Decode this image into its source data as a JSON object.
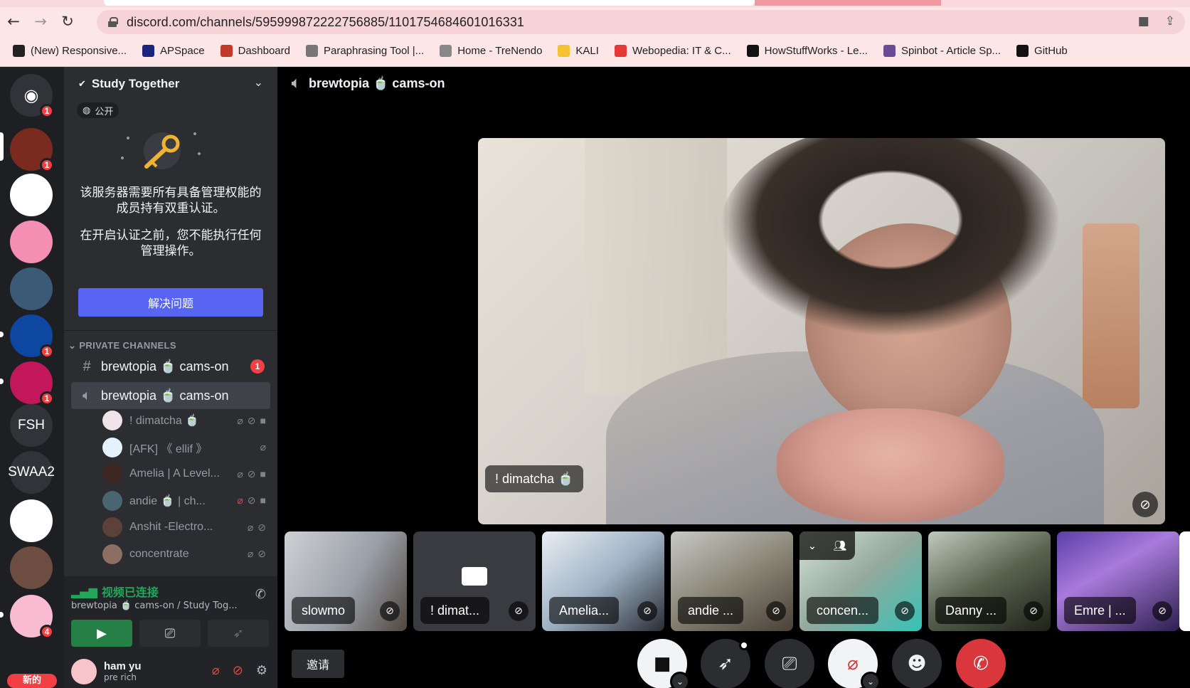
{
  "browser": {
    "url": "discord.com/channels/595999872222756885/1101754684601016331",
    "bookmarks": [
      {
        "label": "(New) Responsive...",
        "icon": "fc-logo-icon",
        "color": "#222"
      },
      {
        "label": "APSpace",
        "icon": "ap-icon",
        "color": "#1a237e"
      },
      {
        "label": "Dashboard",
        "icon": "dashboard-icon",
        "color": "#c0392b"
      },
      {
        "label": "Paraphrasing Tool |...",
        "icon": "feather-icon",
        "color": "#777"
      },
      {
        "label": "Home - TreNendo",
        "icon": "t-icon",
        "color": "#888"
      },
      {
        "label": "KALI",
        "icon": "folder-icon",
        "color": "#f4c430"
      },
      {
        "label": "Webopedia: IT & C...",
        "icon": "q-icon",
        "color": "#e53935"
      },
      {
        "label": "HowStuffWorks - Le...",
        "icon": "question-icon",
        "color": "#111"
      },
      {
        "label": "Spinbot - Article Sp...",
        "icon": "spinbot-icon",
        "color": "#6a4c93"
      },
      {
        "label": "GitHub",
        "icon": "github-icon",
        "color": "#111"
      }
    ]
  },
  "guilds": [
    {
      "label": "",
      "icon": "discord-home-icon",
      "badge": "1",
      "color": "#313338"
    },
    {
      "label": "",
      "icon": "server-icon",
      "badge": "1",
      "color": "#7a2a1e"
    },
    {
      "label": "",
      "icon": "server-icon",
      "badge": "",
      "color": "#ffffff"
    },
    {
      "label": "",
      "icon": "server-icon",
      "badge": "",
      "color": "#f48fb1"
    },
    {
      "label": "",
      "icon": "server-icon",
      "badge": "",
      "color": "#3b5a78"
    },
    {
      "label": "",
      "icon": "server-icon",
      "badge": "1",
      "color": "#0d47a1"
    },
    {
      "label": "",
      "icon": "server-icon",
      "badge": "1",
      "color": "#c2185b"
    },
    {
      "label": "FSH",
      "icon": "",
      "badge": "",
      "color": "#313338"
    },
    {
      "label": "SWAA2",
      "icon": "",
      "badge": "",
      "color": "#313338"
    },
    {
      "label": "",
      "icon": "server-icon",
      "badge": "",
      "color": "#ffffff"
    },
    {
      "label": "",
      "icon": "server-icon",
      "badge": "",
      "color": "#6d4c41"
    },
    {
      "label": "",
      "icon": "server-icon",
      "badge": "4",
      "color": "#f8bbd0"
    }
  ],
  "new_label": "新的",
  "server": {
    "name": "Study Together",
    "public_tag": "公开",
    "notice_1": "该服务器需要所有具备管理权能的成员持有双重认证。",
    "notice_2": "在开启认证之前，您不能执行任何管理操作。",
    "resolve_button": "解决问题",
    "category": "PRIVATE CHANNELS",
    "text_channel": {
      "name": "brewtopia 🍵 cams-on",
      "badge": "1"
    },
    "voice_channel": {
      "name": "brewtopia 🍵 cams-on"
    },
    "members": [
      {
        "name": "! dimatcha 🍵",
        "muted": false,
        "deaf_red": false,
        "video": true,
        "color": "#f0e4e8"
      },
      {
        "name": "[AFK] 《 ellif 》",
        "muted": false,
        "deaf_red": false,
        "video": false,
        "color": "#e3f2fd"
      },
      {
        "name": "Amelia | A Level...",
        "muted": false,
        "deaf_red": false,
        "video": true,
        "color": "#3e2723"
      },
      {
        "name": "andie 🍵 | ch...",
        "muted": true,
        "deaf_red": false,
        "video": true,
        "color": "#4a6572"
      },
      {
        "name": "Anshit -Electro...",
        "muted": false,
        "deaf_red": false,
        "video": false,
        "color": "#5d4037"
      },
      {
        "name": "concentrate",
        "muted": false,
        "deaf_red": false,
        "video": false,
        "color": "#8d6e63"
      }
    ]
  },
  "voice_status": {
    "title": "视频已连接",
    "subtitle": "brewtopia 🍵 cams-on / Study Tog..."
  },
  "user": {
    "name": "ham yu",
    "status": "pre rich"
  },
  "stage": {
    "title": "brewtopia 🍵 cams-on",
    "main_name": "! dimatcha 🍵",
    "tiles": [
      {
        "name": "slowmo",
        "bg": "linear-gradient(120deg,#cfd0d4,#9aa0a8 55%,#50463e)"
      },
      {
        "name": "! dimat...",
        "bg": "#3a3b40"
      },
      {
        "name": "Amelia...",
        "bg": "linear-gradient(140deg,#e9eef2,#9eb2c4 50%,#2a2c33)"
      },
      {
        "name": "andie ...",
        "bg": "linear-gradient(150deg,#c7c8c4,#8a8677 50%,#4a4038)"
      },
      {
        "name": "concen...",
        "bg": "linear-gradient(140deg,#d5e2d6,#94a89c 50%,#35c3b6)"
      },
      {
        "name": "Danny ...",
        "bg": "linear-gradient(150deg,#bfcabb,#59624f 50%,#1e2218)"
      },
      {
        "name": "Emre | ...",
        "bg": "linear-gradient(150deg,#5b3fa8,#a87adb 40%,#2d1f4f)"
      }
    ],
    "invite": "邀请"
  }
}
